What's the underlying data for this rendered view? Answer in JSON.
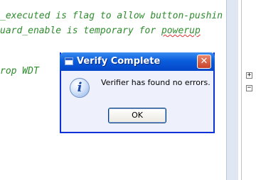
{
  "editor": {
    "lines": [
      "_executed is flag to allow button-pushin",
      "uard_enable is temporary for ",
      "rop WDT"
    ],
    "squiggle_word": "powerup"
  },
  "gutter": {
    "fold_markers": [
      "+",
      "−"
    ]
  },
  "dialog": {
    "title": "Verify Complete",
    "close_glyph": "✕",
    "icon_glyph": "i",
    "message": "Verifier has found no errors.",
    "ok_label": "OK"
  },
  "colors": {
    "code_comment": "#2e8b2e",
    "title_bar": "#0a5ddc",
    "dialog_border": "#0831d9"
  }
}
